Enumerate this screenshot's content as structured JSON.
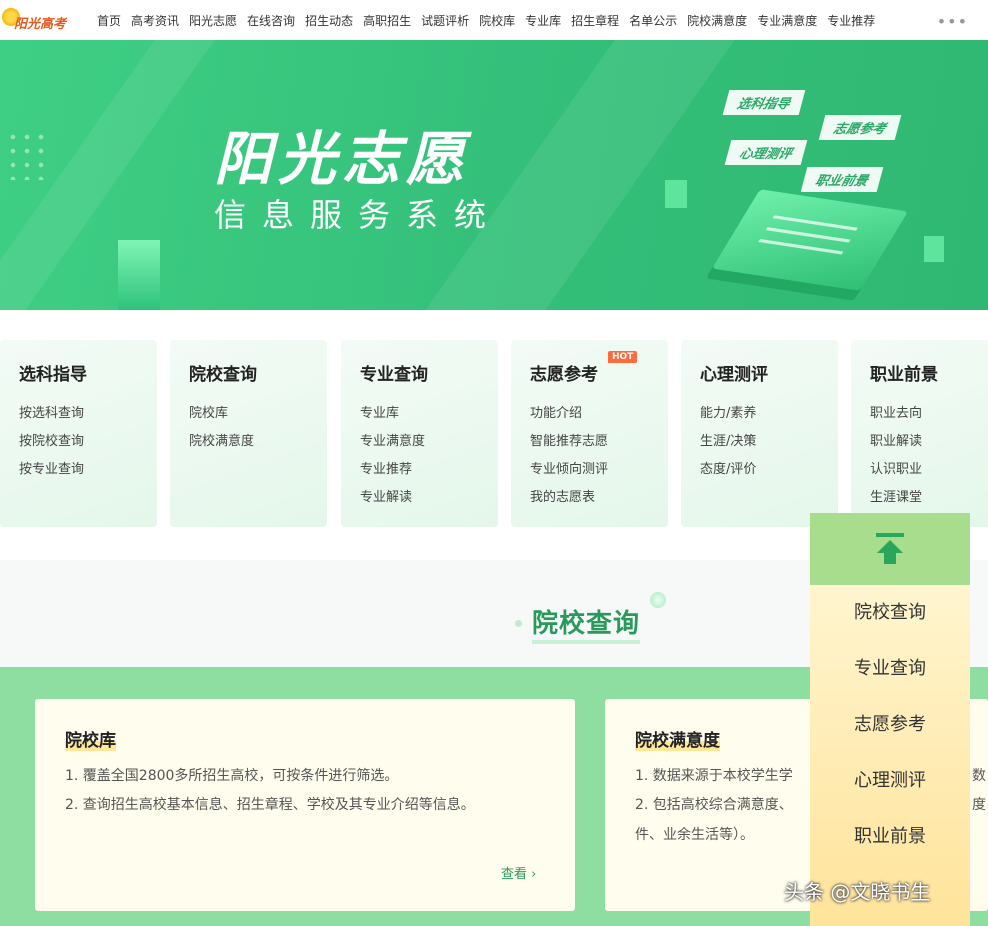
{
  "logo": {
    "text": "阳光高考"
  },
  "nav": {
    "items": [
      "首页",
      "高考资讯",
      "阳光志愿",
      "在线咨询",
      "招生动态",
      "高职招生",
      "试题评析",
      "院校库",
      "专业库",
      "招生章程",
      "名单公示",
      "院校满意度",
      "专业满意度",
      "专业推荐"
    ],
    "more_icon": "more-dots-icon"
  },
  "banner": {
    "title": "阳光志愿",
    "subtitle": "信息服务系统",
    "tags": [
      "选科指导",
      "志愿参考",
      "心理测评",
      "职业前景"
    ]
  },
  "cards": [
    {
      "title": "选科指导",
      "links": [
        "按选科查询",
        "按院校查询",
        "按专业查询"
      ]
    },
    {
      "title": "院校查询",
      "links": [
        "院校库",
        "院校满意度"
      ]
    },
    {
      "title": "专业查询",
      "links": [
        "专业库",
        "专业满意度",
        "专业推荐",
        "专业解读"
      ]
    },
    {
      "title": "志愿参考",
      "badge": "HOT",
      "links": [
        "功能介绍",
        "智能推荐志愿",
        "专业倾向测评",
        "我的志愿表"
      ]
    },
    {
      "title": "心理测评",
      "links": [
        "能力/素养",
        "生涯/决策",
        "态度/评价"
      ]
    },
    {
      "title": "职业前景",
      "links": [
        "职业去向",
        "职业解读",
        "认识职业",
        "生涯课堂"
      ]
    }
  ],
  "section": {
    "title": "院校查询",
    "panels": [
      {
        "title": "院校库",
        "lines": [
          "1. 覆盖全国2800多所招生高校，可按条件进行筛选。",
          "2. 查询招生高校基本信息、招生章程、学校及其专业介绍等信息。"
        ],
        "link": "查看 ›"
      },
      {
        "title": "院校满意度",
        "lines": [
          "1. 数据来源于本校学生学",
          "2. 包括高校综合满意度、",
          "件、业余生活等）。"
        ],
        "cut_right": [
          "数",
          "度"
        ]
      }
    ]
  },
  "float_menu": {
    "top_icon": "back-to-top-icon",
    "items": [
      "院校查询",
      "专业查询",
      "志愿参考",
      "心理测评",
      "职业前景"
    ]
  },
  "watermark": "头条 @文晓书生",
  "colors": {
    "brand_green": "#34c07a",
    "accent_green": "#2a9a5c",
    "panel_bg": "#fffdee",
    "hot": "#ff6a3d"
  }
}
